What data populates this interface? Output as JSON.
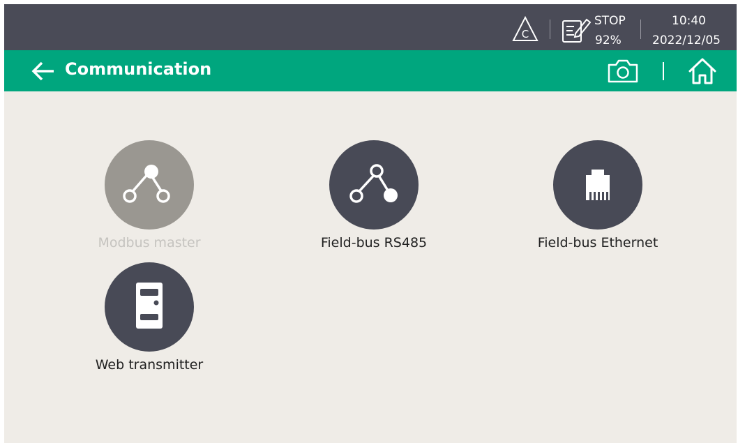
{
  "status_bar": {
    "warning_icon": "warning-c-icon",
    "run_state": "STOP",
    "percent": "92%",
    "time": "10:40",
    "date": "2022/12/05"
  },
  "title_bar": {
    "title": "Communication",
    "back_icon": "arrow-left-icon",
    "camera_icon": "camera-icon",
    "home_icon": "home-icon"
  },
  "menu": {
    "items": [
      {
        "label": "Modbus master",
        "icon": "network-node-icon",
        "enabled": false
      },
      {
        "label": "Field-bus RS485",
        "icon": "network-node-icon",
        "enabled": true
      },
      {
        "label": "Field-bus Ethernet",
        "icon": "ethernet-port-icon",
        "enabled": true
      },
      {
        "label": "Web transmitter",
        "icon": "server-icon",
        "enabled": true
      }
    ]
  },
  "colors": {
    "status_bar_bg": "#4a4b57",
    "title_bar_bg": "#00a67e",
    "content_bg": "#efece7",
    "tile_bg": "#484a56",
    "tile_disabled_bg": "#9a9791"
  }
}
